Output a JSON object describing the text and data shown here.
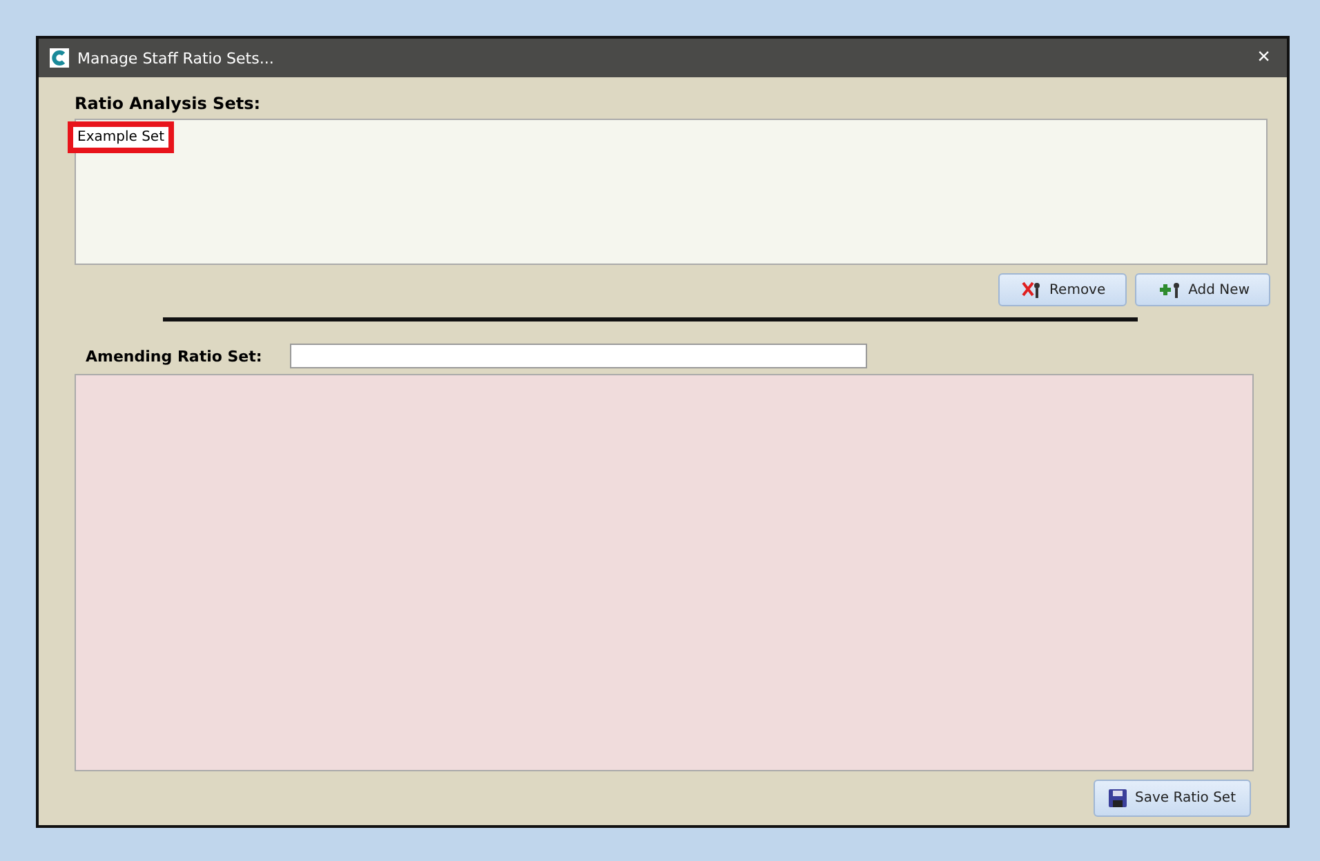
{
  "window": {
    "title": "Manage Staff Ratio Sets...",
    "close": "×"
  },
  "sets": {
    "label": "Ratio Analysis Sets:",
    "items": [
      {
        "label": "Example Set",
        "highlighted": true
      }
    ]
  },
  "set_buttons": [
    {
      "label": "Remove",
      "kind": "remove"
    },
    {
      "label": "Add New",
      "kind": "add"
    }
  ],
  "amending": {
    "label": "Amending Ratio Set:"
  },
  "save_button": {
    "label": "Save Ratio Set"
  }
}
